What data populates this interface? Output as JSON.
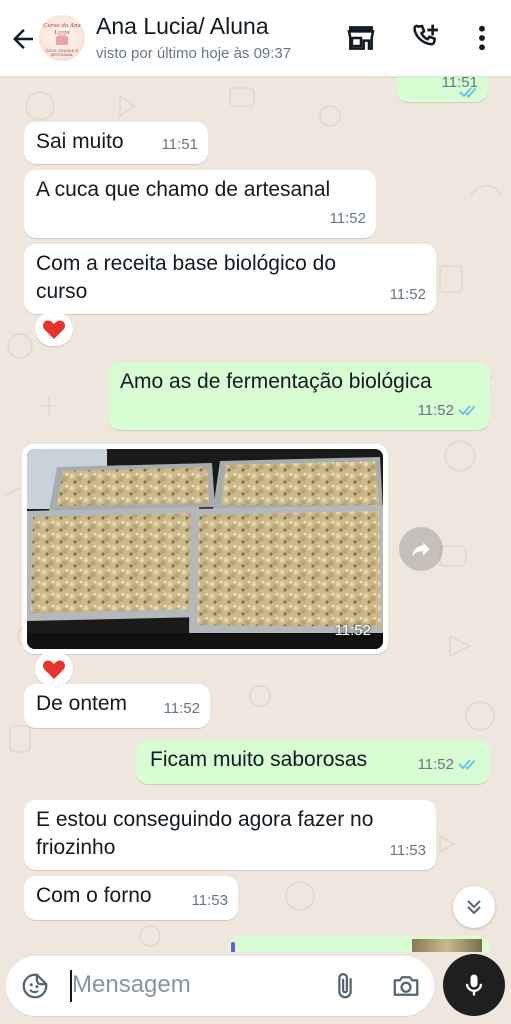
{
  "header": {
    "contact_name": "Ana Lucia/ Aluna",
    "last_seen": "visto por último hoje às 09:37",
    "avatar_text_top": "Curso da Ana Lucia",
    "avatar_text_bottom": "DOCE GRANDE E ARTESANAL",
    "icons": [
      "back-arrow-icon",
      "store-icon",
      "add-call-icon",
      "more-vertical-icon"
    ]
  },
  "messages": [
    {
      "dir": "out",
      "text": "",
      "time": "11:51",
      "read": true
    },
    {
      "dir": "in",
      "text": "Sai muito",
      "time": "11:51"
    },
    {
      "dir": "in",
      "text": "A cuca que chamo de artesanal",
      "time": "11:52"
    },
    {
      "dir": "in",
      "text": "Com a receita base biológico do curso",
      "time": "11:52",
      "reaction": "❤"
    },
    {
      "dir": "out",
      "text": "Amo as de fermentação biológica",
      "time": "11:52",
      "read": true
    },
    {
      "dir": "in",
      "type": "image",
      "time": "11:52",
      "reaction": "❤"
    },
    {
      "dir": "in",
      "text": "De ontem",
      "time": "11:52"
    },
    {
      "dir": "out",
      "text": "Ficam muito saborosas",
      "time": "11:52",
      "read": true
    },
    {
      "dir": "in",
      "text": "E estou conseguindo agora fazer no friozinho",
      "time": "11:53"
    },
    {
      "dir": "in",
      "text": "Com o forno",
      "time": "11:53"
    }
  ],
  "composer": {
    "placeholder": "Mensagem"
  },
  "colors": {
    "outgoing_bubble": "#d9fdd3",
    "incoming_bubble": "#ffffff",
    "chat_background": "#efe7dd",
    "read_ticks": "#53bdeb",
    "mic_button": "#1f1f1f"
  }
}
